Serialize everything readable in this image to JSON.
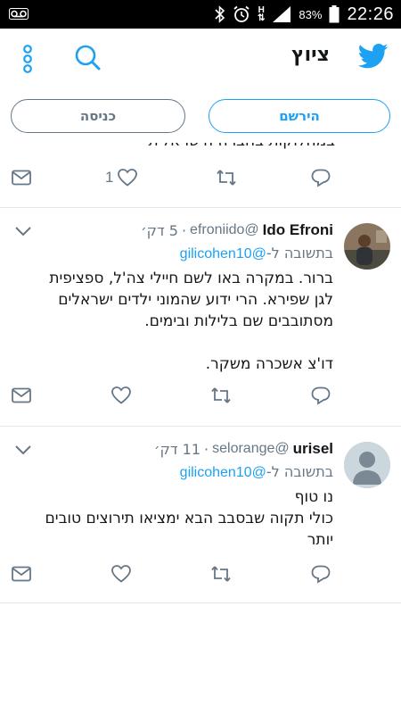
{
  "status_bar": {
    "battery_percent": "83%",
    "time": "22:26",
    "network_type": "H",
    "icons": [
      "voicemail-icon",
      "bluetooth-icon",
      "alarm-icon",
      "signal-icon",
      "battery-icon"
    ]
  },
  "header": {
    "title": "ציוץ",
    "icons": [
      "menu-dots-icon",
      "search-icon",
      "twitter-bird-icon"
    ]
  },
  "auth": {
    "login_label": "כניסה",
    "signup_label": "הירשם"
  },
  "previous_tweet": {
    "cut_text": "במחלוקות בחברה הישראלית",
    "like_count": "1"
  },
  "tweets": [
    {
      "name": "Ido Efroni",
      "handle": "@efroniido",
      "separator": "·",
      "time": "5 דק׳",
      "reply_prefix": "בתשובה ל-",
      "reply_mention": "@gilicohen10",
      "text": "ברור.  במקרה באו לשם חיילי צה'ל,  ספציפית\nלגן שפירא.  הרי ידוע שהמוני ילדים ישראלים\nמסתובבים שם בלילות ובימים.\n\nדו'צ אשכרה משקר."
    },
    {
      "name": "urisel",
      "handle": "@selorange",
      "separator": "·",
      "time": "11 דק׳",
      "reply_prefix": "בתשובה ל-",
      "reply_mention": "@gilicohen10",
      "text": "נו טוף\nכולי תקוה שבסבב הבא ימציאו תירוצים טובים\nיותר"
    }
  ],
  "colors": {
    "twitter_blue": "#1da1f2",
    "secondary_gray": "#657786",
    "divider": "#e1e8ed"
  }
}
